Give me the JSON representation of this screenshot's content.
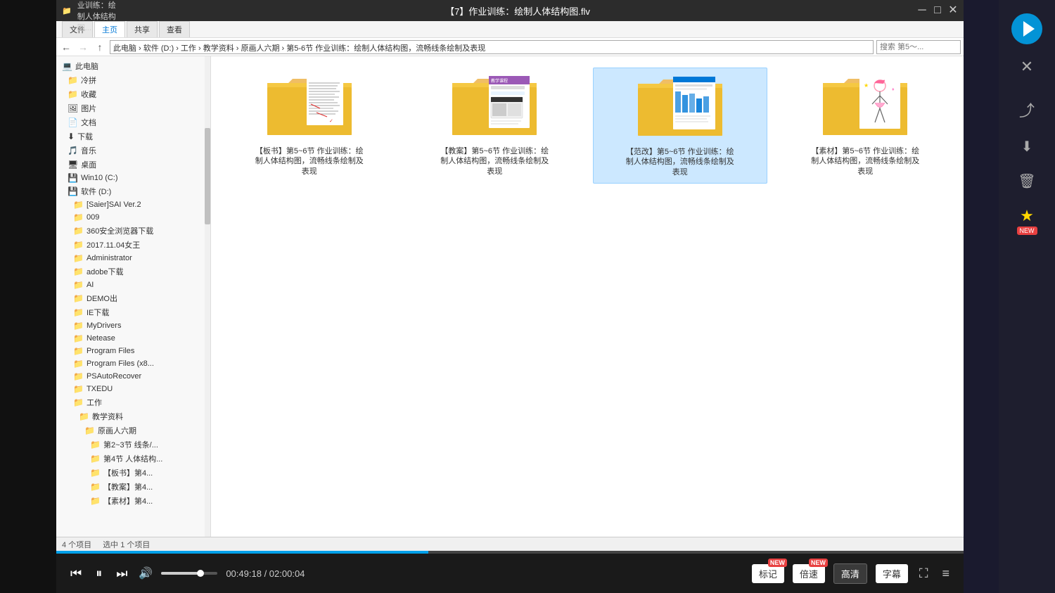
{
  "window": {
    "title": "【7】作业训练：绘制人体结构图.flv",
    "controls": [
      "─",
      "□",
      "✕"
    ]
  },
  "explorer": {
    "titlebar_text": "第5~6节 作业训练：绘制人体结构图，流畅线条绘制及表现",
    "tabs": [
      {
        "label": "文件",
        "active": false
      },
      {
        "label": "主页",
        "active": false
      },
      {
        "label": "共享",
        "active": false
      },
      {
        "label": "查看",
        "active": false
      }
    ],
    "address": "此电脑 › 软件 (D:) › 工作 › 教学资料 › 原画人六期 › 第5-6节 作业训练：绘制人体结构图，流畅线条绘制及表现",
    "search_placeholder": "搜索 第5～...",
    "sidebar": [
      {
        "label": "此电脑",
        "indent": 0,
        "icon": "💻",
        "expanded": true
      },
      {
        "label": "冷拼",
        "indent": 1,
        "icon": "📁"
      },
      {
        "label": "收藏",
        "indent": 1,
        "icon": "📁"
      },
      {
        "label": "图片",
        "indent": 1,
        "icon": "🖼"
      },
      {
        "label": "文档",
        "indent": 1,
        "icon": "📄"
      },
      {
        "label": "下载",
        "indent": 1,
        "icon": "⬇"
      },
      {
        "label": "音乐",
        "indent": 1,
        "icon": "🎵"
      },
      {
        "label": "桌面",
        "indent": 1,
        "icon": "🖥"
      },
      {
        "label": "Win10 (C:)",
        "indent": 1,
        "icon": "💾"
      },
      {
        "label": "软件 (D:)",
        "indent": 1,
        "icon": "💾",
        "expanded": true
      },
      {
        "label": "[Saier]SAI Ver.2",
        "indent": 2,
        "icon": "📁"
      },
      {
        "label": "009",
        "indent": 2,
        "icon": "📁"
      },
      {
        "label": "360安全浏览器下载",
        "indent": 2,
        "icon": "📁"
      },
      {
        "label": "2017.11.04女王",
        "indent": 2,
        "icon": "📁"
      },
      {
        "label": "Administrator",
        "indent": 2,
        "icon": "📁"
      },
      {
        "label": "adobe下载",
        "indent": 2,
        "icon": "📁"
      },
      {
        "label": "AI",
        "indent": 2,
        "icon": "📁"
      },
      {
        "label": "DEMO出",
        "indent": 2,
        "icon": "📁"
      },
      {
        "label": "IE下载",
        "indent": 2,
        "icon": "📁"
      },
      {
        "label": "MyDrivers",
        "indent": 2,
        "icon": "📁"
      },
      {
        "label": "Netease",
        "indent": 2,
        "icon": "📁"
      },
      {
        "label": "Program Files",
        "indent": 2,
        "icon": "📁"
      },
      {
        "label": "Program Files (x8...",
        "indent": 2,
        "icon": "📁"
      },
      {
        "label": "PSAutoRecover",
        "indent": 2,
        "icon": "📁"
      },
      {
        "label": "TXEDU",
        "indent": 2,
        "icon": "📁"
      },
      {
        "label": "工作",
        "indent": 2,
        "icon": "📁",
        "expanded": true
      },
      {
        "label": "教学资料",
        "indent": 3,
        "icon": "📁",
        "expanded": true
      },
      {
        "label": "原画人六期",
        "indent": 4,
        "icon": "📁",
        "expanded": true
      },
      {
        "label": "第2~3节 线条/...",
        "indent": 5,
        "icon": "📁"
      },
      {
        "label": "第4节 人体结构...",
        "indent": 5,
        "icon": "📁"
      },
      {
        "label": "【板书】第4...",
        "indent": 5,
        "icon": "📁"
      },
      {
        "label": "【教案】第4...",
        "indent": 5,
        "icon": "📁"
      },
      {
        "label": "【素材】第4...",
        "indent": 5,
        "icon": "📁"
      }
    ],
    "folders": [
      {
        "name": "【板书】第5~6节 作业训练：绘制人体结构图，流畅线条绘制及表现",
        "type": "handwritten",
        "selected": false
      },
      {
        "name": "【教案】第5~6节 作业训练：绘制人体结构图，流畅线条绘制及表现",
        "type": "lesson",
        "selected": false
      },
      {
        "name": "【范改】第5~6节 作业训练：绘制人体结构图，流畅线条绘制及表现",
        "type": "correction",
        "selected": true
      },
      {
        "name": "【素材】第5~6节 作业训练：绘制人体结构图，流畅线条绘制及表现",
        "type": "anime",
        "selected": false
      }
    ],
    "status": {
      "item_count": "4 个项目",
      "selected": "选中 1 个项目"
    }
  },
  "video_controls": {
    "progress_percent": 41,
    "time_current": "00:49:18",
    "time_total": "02:00:04",
    "buttons": {
      "prev": "⏮",
      "play": "⏸",
      "next": "⏭",
      "volume_icon": "🔊",
      "biaoji": "标记",
      "biaoji_new": true,
      "beisu": "倍速",
      "beisu_new": true,
      "gaofenbian": "高清",
      "zimu": "字幕",
      "fullscreen": "⛶",
      "menu": "≡"
    },
    "volume_percent": 65
  },
  "right_panel": {
    "close_label": "✕",
    "icons": [
      {
        "name": "share",
        "symbol": "⤴",
        "new": false
      },
      {
        "name": "download",
        "symbol": "⬇",
        "new": false
      },
      {
        "name": "delete",
        "symbol": "🗑",
        "new": false
      },
      {
        "name": "star",
        "symbol": "★",
        "new": true
      }
    ]
  }
}
